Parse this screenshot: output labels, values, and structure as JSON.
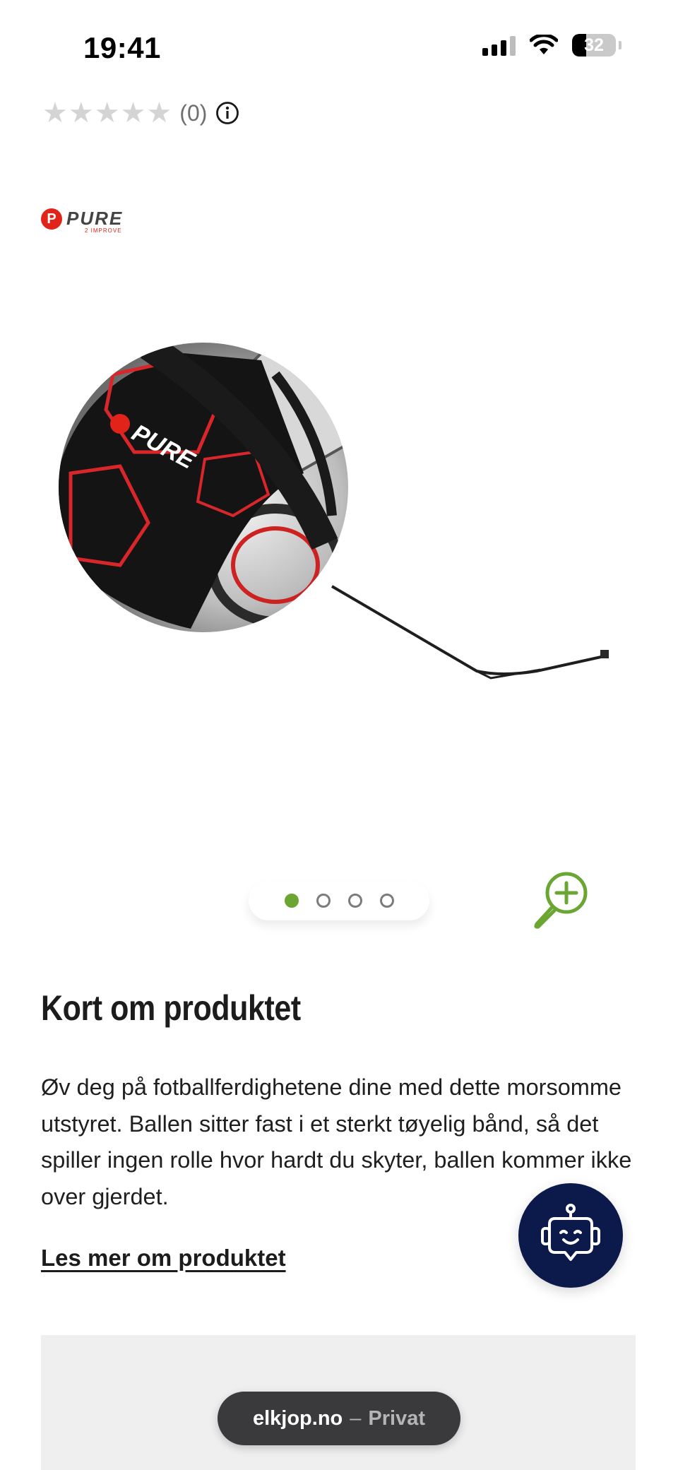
{
  "status_bar": {
    "time": "19:41",
    "battery": "32",
    "battery_fraction": 0.32
  },
  "rating": {
    "stars_total": 5,
    "stars_filled": 0,
    "count": "(0)"
  },
  "brand": {
    "name": "PURE",
    "tagline": "2 IMPROVE",
    "mark": "P"
  },
  "product_image": {
    "ball_brand_text": "PURE"
  },
  "carousel": {
    "total": 4,
    "active_index": 0
  },
  "content": {
    "title": "Kort om produktet",
    "description": "Øv deg på fotballferdighetene dine med dette morsomme utstyret. Ballen sitter fast i et sterkt tøyelig bånd, så det spiller ingen rolle hvor hardt du skyter, ballen kommer ikke over gjerdet.",
    "read_more": "Les mer om produktet"
  },
  "browser": {
    "domain": "elkjop.no",
    "separator": "–",
    "mode": "Privat"
  },
  "colors": {
    "accent_green": "#6aa631",
    "chat_navy": "#0b1a4b",
    "brand_red": "#e2231a"
  },
  "icons": {
    "info": "info-icon",
    "zoom": "zoom-in-icon",
    "chat": "chatbot-icon",
    "wifi": "wifi-icon",
    "signal": "signal-icon",
    "battery": "battery-icon"
  }
}
